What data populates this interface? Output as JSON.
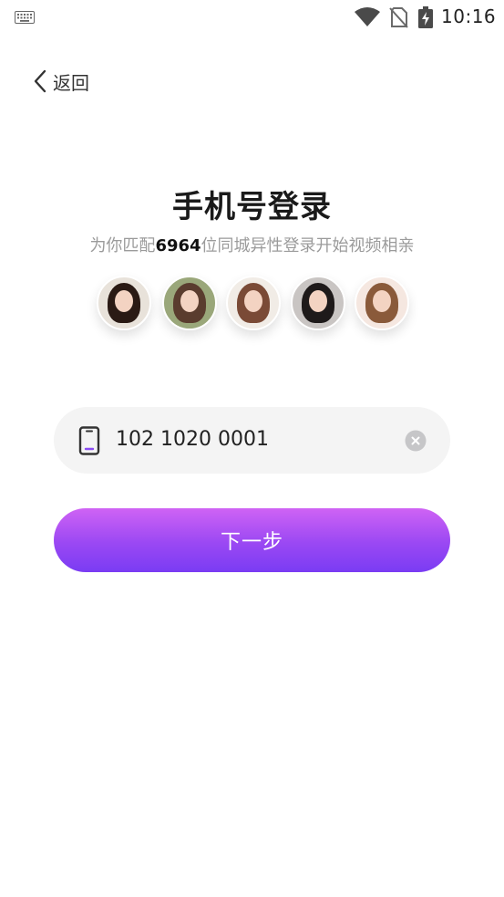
{
  "status_bar": {
    "time": "10:16",
    "icons": [
      "keyboard-icon",
      "wifi-icon",
      "no-sim-icon",
      "battery-charging-icon"
    ]
  },
  "nav": {
    "back_label": "返回"
  },
  "login": {
    "title": "手机号登录",
    "subtitle_prefix": "为你匹配",
    "match_count": "6964",
    "subtitle_suffix": "位同城异性登录开始视频相亲",
    "avatars": [
      {
        "hair": "#2a1a14",
        "top": "#e8e2da"
      },
      {
        "hair": "#5a3c2e",
        "top": "#9aa77a"
      },
      {
        "hair": "#7a4a36",
        "top": "#f1ece6"
      },
      {
        "hair": "#1e1a1a",
        "top": "#c9c5c3"
      },
      {
        "hair": "#8a5a3a",
        "top": "#f5e7e0"
      }
    ]
  },
  "phone_input": {
    "value": "102 1020 0001",
    "icon": "phone-icon",
    "clear_icon": "clear-icon"
  },
  "next_button": {
    "label": "下一步"
  },
  "colors": {
    "button_gradient_top": "#cf63f4",
    "button_gradient_bottom": "#7a3cf3",
    "input_bg": "#f4f4f4",
    "subtitle": "#9b9b9b"
  }
}
